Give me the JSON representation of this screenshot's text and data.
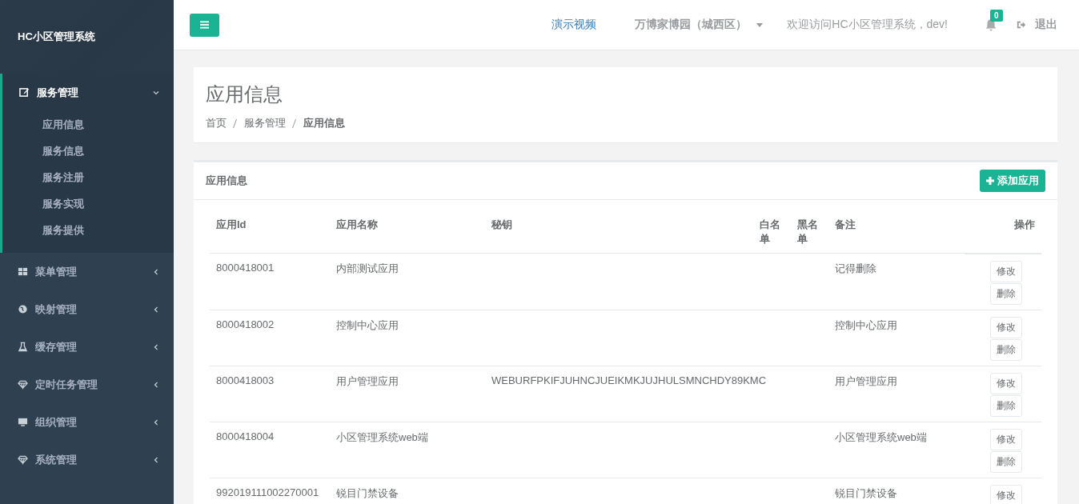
{
  "sidebar": {
    "title": "HC小区管理系统",
    "menu": [
      {
        "label": "服务管理",
        "kind": "edit",
        "expanded": true,
        "children": [
          {
            "label": "应用信息"
          },
          {
            "label": "服务信息"
          },
          {
            "label": "服务注册"
          },
          {
            "label": "服务实现"
          },
          {
            "label": "服务提供"
          }
        ]
      },
      {
        "label": "菜单管理",
        "kind": "grid",
        "expanded": false
      },
      {
        "label": "映射管理",
        "kind": "globe",
        "expanded": false
      },
      {
        "label": "缓存管理",
        "kind": "flask",
        "expanded": false
      },
      {
        "label": "定时任务管理",
        "kind": "diamond",
        "expanded": false
      },
      {
        "label": "组织管理",
        "kind": "monitor",
        "expanded": false
      },
      {
        "label": "系统管理",
        "kind": "diamond",
        "expanded": false
      }
    ]
  },
  "topbar": {
    "demo_link": "演示视频",
    "community": "万博家博园（城西区）",
    "welcome": "欢迎访问HC小区管理系统，dev!",
    "notifications": "0",
    "logout": "退出"
  },
  "page_header": {
    "title": "应用信息",
    "breadcrumb": [
      "首页",
      "服务管理",
      "应用信息"
    ]
  },
  "panel": {
    "title": "应用信息",
    "add_button": "添加应用",
    "table": {
      "columns": [
        "应用Id",
        "应用名称",
        "秘钥",
        "白名单",
        "黑名单",
        "备注",
        "操作"
      ],
      "rows": [
        {
          "id": "8000418001",
          "name": "内部测试应用",
          "secret": "",
          "remark": "记得删除",
          "actions": [
            "修改",
            "删除"
          ]
        },
        {
          "id": "8000418002",
          "name": "控制中心应用",
          "secret": "",
          "remark": "控制中心应用",
          "actions": [
            "修改",
            "删除"
          ]
        },
        {
          "id": "8000418003",
          "name": "用户管理应用",
          "secret": "WEBURFPKIFJUHNCJUEIKMKJUJHULSMNCHDY89KMC",
          "remark": "用户管理应用",
          "actions": [
            "修改",
            "删除"
          ]
        },
        {
          "id": "8000418004",
          "name": "小区管理系统web端",
          "secret": "",
          "remark": "小区管理系统web端",
          "actions": [
            "修改",
            "删除"
          ]
        },
        {
          "id": "992019111002270001",
          "name": "锐目门禁设备",
          "secret": "",
          "remark": "锐目门禁设备",
          "actions": [
            "修改"
          ]
        }
      ]
    }
  }
}
